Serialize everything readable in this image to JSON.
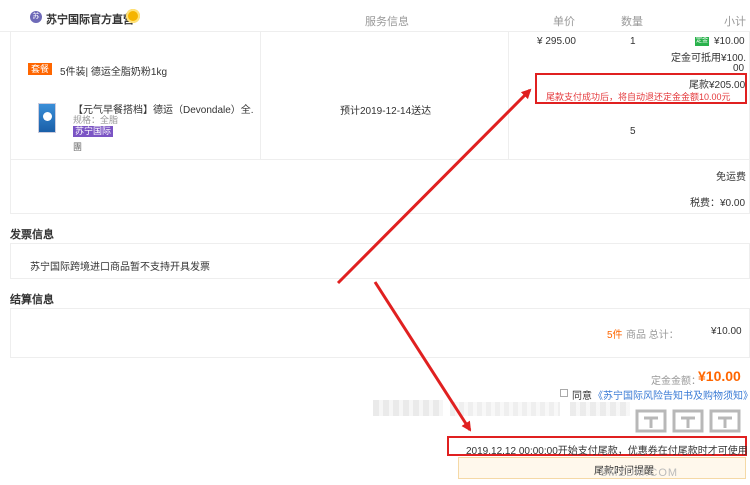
{
  "header": {
    "store_name": "苏宁国际官方直营",
    "store_logo": "苏",
    "col_service": "服务信息",
    "col_price": "单价",
    "col_qty": "数量",
    "col_subtotal": "小计"
  },
  "product": {
    "package_tag": "套餐",
    "package_title": "5件装| 德运全脂奶粉1kg",
    "item_name": "【元气早餐搭档】德运（Devondale）全...",
    "item_spec": "规格：全脂",
    "intl_badge": "苏宁国际",
    "item_extra": "團",
    "ship_date": "预计2019-12-14送达",
    "unit_price": "¥ 295.00",
    "qty_top": "1",
    "qty_bottom": "5",
    "deposit_tag": "定金",
    "deposit_amount": "¥10.00",
    "deposit_deduct": "定金可抵用¥100.",
    "deposit_deduct_cont": "00",
    "final_amount": "尾款¥205.00",
    "refund_note": "尾款支付成功后，将自动退还定金金额10.00元"
  },
  "shipping": {
    "free_shipping": "免运费",
    "tax": "税费：¥0.00"
  },
  "invoice": {
    "title": "发票信息",
    "text": "苏宁国际跨境进口商品暂不支持开具发票"
  },
  "settlement": {
    "title": "结算信息",
    "count": "5件",
    "count_label": "商品 总计：",
    "total": "¥10.00",
    "deposit_total_label": "定金金额：",
    "deposit_total": "¥10.00",
    "agree_label": "同意",
    "agree_link": "《苏宁国际风险告知书及购物须知》"
  },
  "footer": {
    "pay_start": "2019.12.12 00:00:00开始支付尾款，优惠券在付尾款时才可使用",
    "pay_button": "尾款时间提醒",
    "watermark": "SMZDM.COM"
  },
  "colors": {
    "accent": "#ff6600",
    "annotation": "#e02020",
    "link": "#3a7bd5",
    "intl_purple": "#7b54c4"
  }
}
